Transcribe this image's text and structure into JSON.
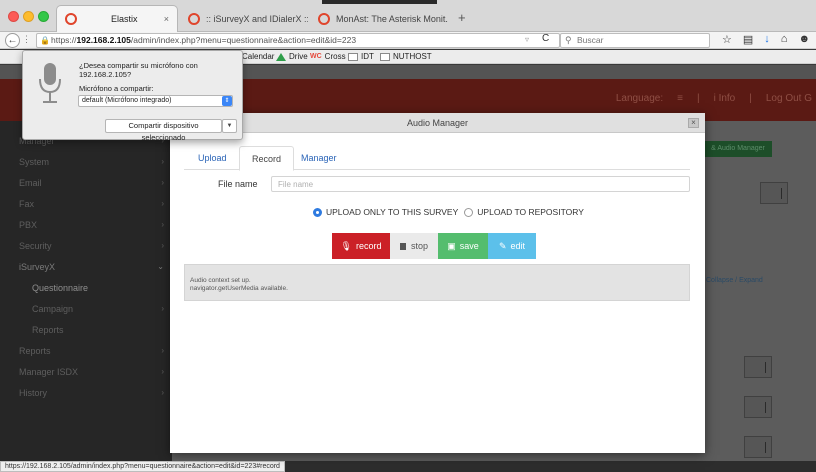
{
  "browser": {
    "tabs": [
      {
        "title": "Elastix",
        "active": true
      },
      {
        "title": ":: iSurveyX and IDialerX ::",
        "active": false
      },
      {
        "title": "MonAst: The Asterisk Monit...",
        "active": false
      }
    ],
    "tab_close": "×",
    "new_tab": "+",
    "url_prefix": "https://",
    "url_host": "192.168.2.105",
    "url_path": "/admin/index.php?menu=questionnaire&action=edit&id=223",
    "search_placeholder": "Buscar",
    "bookmarks": {
      "close": "×",
      "items": [
        "Calendar",
        "Drive",
        "Cross",
        "IDT",
        "NUTHOST"
      ]
    },
    "status_url": "https://192.168.2.105/admin/index.php?menu=questionnaire&action=edit&id=223#record"
  },
  "mic_prompt": {
    "question": "¿Desea compartir su micrófono con 192.168.2.105?",
    "share_label": "Micrófono a compartir:",
    "selected_device": "default (Micrófono integrado)",
    "share_button": "Compartir dispositivo seleccionado"
  },
  "app": {
    "header_items": [
      "Language:",
      "≡",
      "|",
      "i Info",
      "|",
      "Log Out G"
    ],
    "sidebar": [
      {
        "label": "Manager",
        "chevron": "›"
      },
      {
        "label": "System",
        "chevron": "›"
      },
      {
        "label": "Email",
        "chevron": "›"
      },
      {
        "label": "Fax",
        "chevron": "›"
      },
      {
        "label": "PBX",
        "chevron": "›"
      },
      {
        "label": "Security",
        "chevron": "›"
      },
      {
        "label": "iSurveyX",
        "chevron": "⌄"
      },
      {
        "label": "Questionnaire",
        "chevron": ""
      },
      {
        "label": "Campaign",
        "chevron": "›"
      },
      {
        "label": "Reports",
        "chevron": ""
      },
      {
        "label": "Reports",
        "chevron": "›"
      },
      {
        "label": "Manager ISDX",
        "chevron": "›"
      },
      {
        "label": "History",
        "chevron": "›"
      }
    ],
    "audio_manager_button": "& Audio Manager",
    "collapse_link": "Collapse / Expand"
  },
  "modal": {
    "title": "Audio Manager",
    "close": "×",
    "tabs": [
      "Upload",
      "Record",
      "Manager"
    ],
    "active_tab": "Record",
    "file_name_label": "File name",
    "file_name_placeholder": "File name",
    "file_name_value": "",
    "radio_survey": "UPLOAD ONLY TO THIS SURVEY",
    "radio_repository": "UPLOAD TO REPOSITORY",
    "buttons": {
      "record": "record",
      "stop": "stop",
      "save": "save",
      "edit": "edit"
    },
    "log_lines": [
      "Audio context set up.",
      "navigator.getUserMedia available."
    ]
  },
  "colors": {
    "record": "#cb2027",
    "save": "#54bd6e",
    "edit": "#5cc0ea",
    "link": "#2a64b7",
    "header": "#5b1a14"
  }
}
